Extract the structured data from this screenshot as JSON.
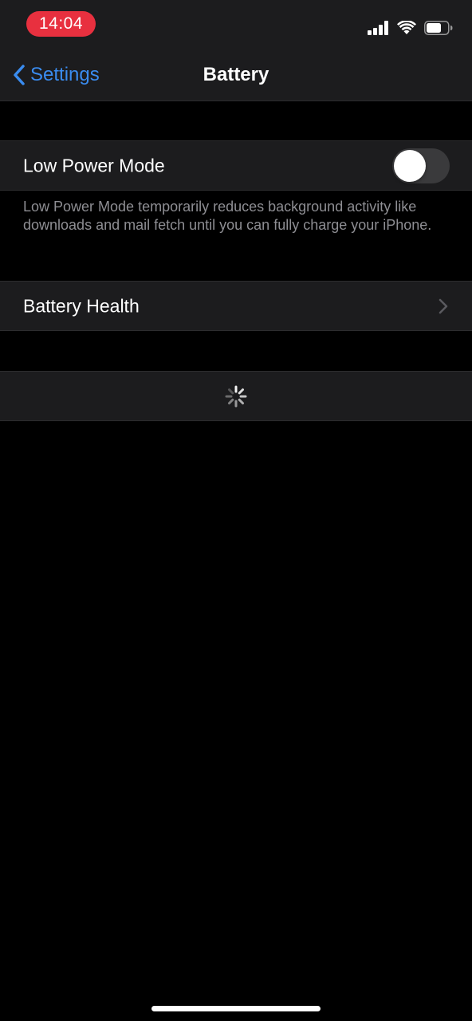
{
  "status_bar": {
    "time": "14:04",
    "icons": [
      "cellular-signal-icon",
      "wifi-icon",
      "battery-icon"
    ],
    "time_pill_color": "#e8303f"
  },
  "nav": {
    "back_label": "Settings",
    "title": "Battery",
    "accent_color": "#3a8cf0"
  },
  "low_power": {
    "label": "Low Power Mode",
    "enabled": false,
    "description": "Low Power Mode temporarily reduces background activity like downloads and mail fetch until you can fully charge your iPhone."
  },
  "battery_health": {
    "label": "Battery Health"
  },
  "loading": {
    "icon": "activity-spinner-icon"
  },
  "colors": {
    "background": "#000000",
    "cell_background": "#1c1c1e",
    "secondary_text": "#8e8e93"
  }
}
